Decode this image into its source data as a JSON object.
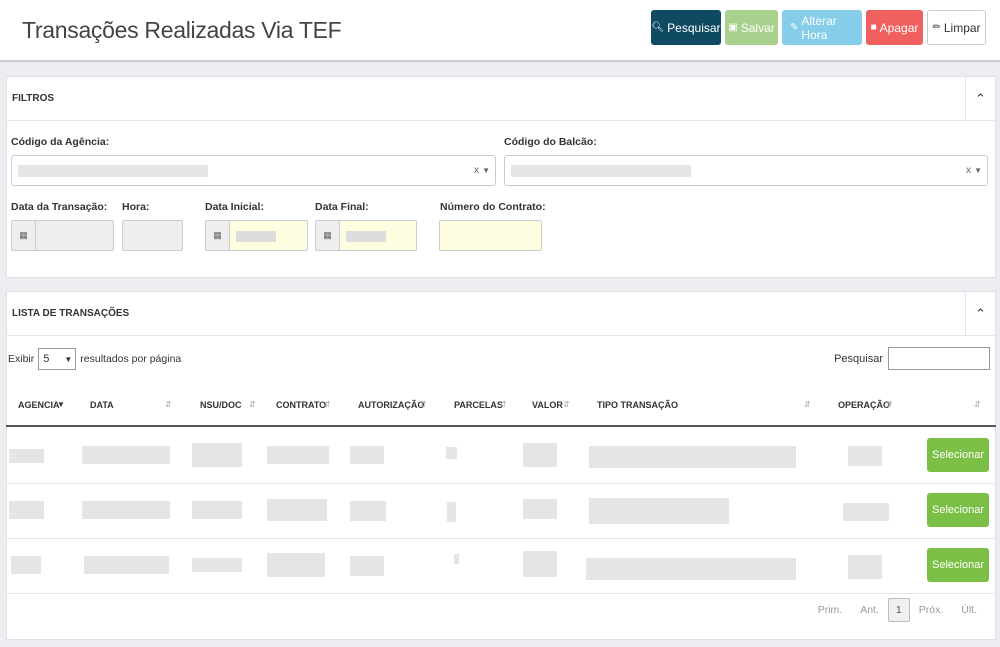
{
  "header": {
    "title": "Transações Realizadas Via TEF",
    "buttons": {
      "search": "Pesquisar",
      "save": "Salvar",
      "change_time": "Alterar Hora",
      "delete": "Apagar",
      "clear": "Limpar"
    }
  },
  "filters": {
    "title": "FILTROS",
    "agency_label": "Código da Agência:",
    "counter_label": "Código do Balcão:",
    "transaction_date_label": "Data da Transação:",
    "time_label": "Hora:",
    "start_date_label": "Data Inicial:",
    "end_date_label": "Data Final:",
    "contract_number_label": "Número do Contrato:",
    "clear_glyph": "x",
    "arrow_glyph": "▼"
  },
  "list": {
    "title": "LISTA DE TRANSAÇÕES",
    "show_label": "Exibir",
    "page_size": "5",
    "per_page_label": "resultados por página",
    "search_label": "Pesquisar",
    "columns": [
      "AGENCIA",
      "DATA",
      "NSU/DOC",
      "CONTRATO",
      "AUTORIZAÇÃO",
      "PARCELAS",
      "VALOR",
      "TIPO TRANSAÇÃO",
      "OPERAÇÃO"
    ],
    "select_label": "Selecionar",
    "rows": 3
  },
  "pagination": {
    "first": "Prim.",
    "prev": "Ant.",
    "current": "1",
    "next": "Próx.",
    "last": "Últ."
  },
  "colors": {
    "search": "#0e4a62",
    "save": "#a9d18e",
    "change_time": "#85cde8",
    "delete": "#f0605f",
    "select": "#7bbf47",
    "highlight_input": "#fefde0"
  }
}
